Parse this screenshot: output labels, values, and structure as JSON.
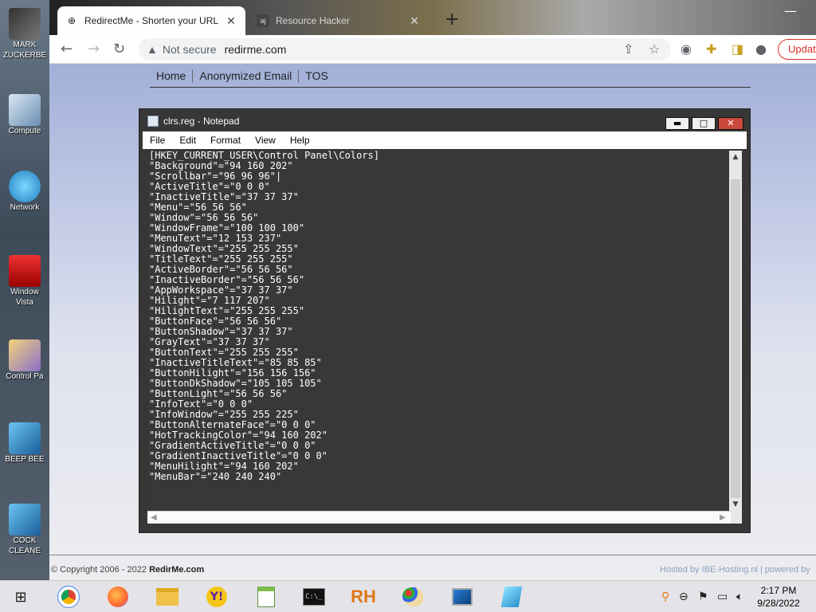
{
  "desktop": {
    "icons": [
      {
        "label": "MARK\nZUCKERBE"
      },
      {
        "label": "Compute"
      },
      {
        "label": "Network"
      },
      {
        "label": "Window\nVista"
      },
      {
        "label": "Control Pa"
      },
      {
        "label": "BEEP BEE"
      },
      {
        "label": "COCK\nCLEANE"
      }
    ]
  },
  "browser": {
    "tabs": [
      {
        "title": "RedirectMe - Shorten your URL",
        "favicon": "globe-icon"
      },
      {
        "title": "Resource Hacker",
        "favicon": "aj"
      }
    ],
    "address": {
      "security": "Not secure",
      "url": "redirme.com"
    },
    "update_label": "Updat"
  },
  "site": {
    "nav": [
      "Home",
      "Anonymized Email",
      "TOS"
    ],
    "footer_prefix": "© Copyright 2006 - 2022",
    "footer_brand": "RedirMe.com",
    "hosted": "Hosted by IBE-Hosting.nl  |  powered by"
  },
  "notepad": {
    "title": "clrs.reg - Notepad",
    "menu": [
      "File",
      "Edit",
      "Format",
      "View",
      "Help"
    ],
    "lines": [
      "[HKEY_CURRENT_USER\\Control Panel\\Colors]",
      "\"Background\"=\"94 160 202\"",
      "\"Scrollbar\"=\"96 96 96\"|",
      "\"ActiveTitle\"=\"0 0 0\"",
      "\"InactiveTitle\"=\"37 37 37\"",
      "\"Menu\"=\"56 56 56\"",
      "\"Window\"=\"56 56 56\"",
      "\"WindowFrame\"=\"100 100 100\"",
      "\"MenuText\"=\"12 153 237\"",
      "\"WindowText\"=\"255 255 255\"",
      "\"TitleText\"=\"255 255 255\"",
      "\"ActiveBorder\"=\"56 56 56\"",
      "\"InactiveBorder\"=\"56 56 56\"",
      "\"AppWorkspace\"=\"37 37 37\"",
      "\"Hilight\"=\"7 117 207\"",
      "\"HilightText\"=\"255 255 255\"",
      "\"ButtonFace\"=\"56 56 56\"",
      "\"ButtonShadow\"=\"37 37 37\"",
      "\"GrayText\"=\"37 37 37\"",
      "\"ButtonText\"=\"255 255 255\"",
      "\"InactiveTitleText\"=\"85 85 85\"",
      "\"ButtonHilight\"=\"156 156 156\"",
      "\"ButtonDkShadow\"=\"105 105 105\"",
      "\"ButtonLight\"=\"56 56 56\"",
      "\"InfoText\"=\"0 0 0\"",
      "\"InfoWindow\"=\"255 255 225\"",
      "\"ButtonAlternateFace\"=\"0 0 0\"",
      "\"HotTrackingColor\"=\"94 160 202\"",
      "\"GradientActiveTitle\"=\"0 0 0\"",
      "\"GradientInactiveTitle\"=\"0 0 0\"",
      "\"MenuHilight\"=\"94 160 202\"",
      "\"MenuBar\"=\"240 240 240\""
    ]
  },
  "taskbar": {
    "time": "2:17 PM",
    "date": "9/28/2022"
  },
  "colors": {
    "update_accent": "#d93025",
    "notepad_bg": "#383838",
    "page_gradient_top": "#a2b0d8"
  }
}
